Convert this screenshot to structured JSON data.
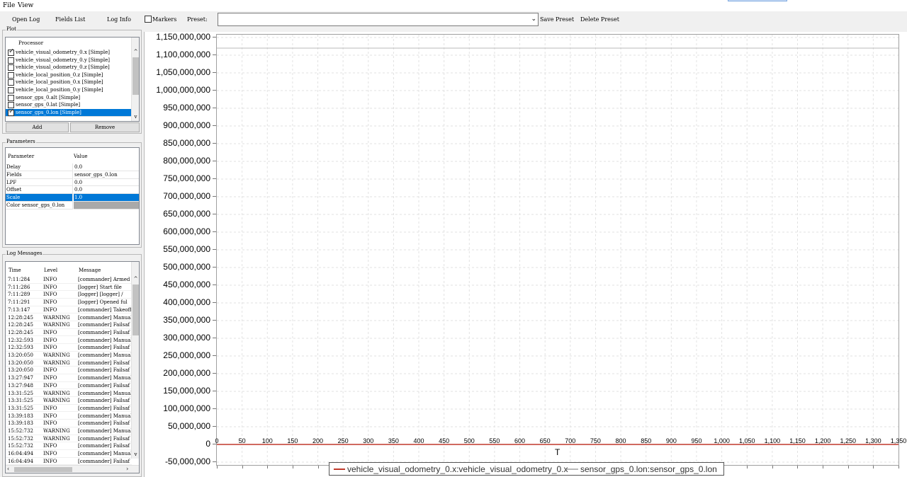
{
  "menu": {
    "file": "File",
    "view": "View"
  },
  "toolbar": {
    "open_log": "Open Log",
    "fields_list": "Fields List",
    "log_info": "Log Info",
    "markers": "Markers",
    "preset_label": "Preset:",
    "preset_value": "",
    "save_preset": "Save Preset",
    "delete_preset": "Delete Preset"
  },
  "plot_group": {
    "title": "Plot",
    "header": "Processor",
    "items": [
      {
        "label": "vehicle_visual_odometry_0.x [Simple]",
        "checked": true
      },
      {
        "label": "vehicle_visual_odometry_0.y [Simple]",
        "checked": false
      },
      {
        "label": "vehicle_visual_odometry_0.z [Simple]",
        "checked": false
      },
      {
        "label": "vehicle_local_position_0.z [Simple]",
        "checked": false
      },
      {
        "label": "vehicle_local_position_0.x [Simple]",
        "checked": false
      },
      {
        "label": "vehicle_local_position_0.y [Simple]",
        "checked": false
      },
      {
        "label": "sensor_gps_0.alt [Simple]",
        "checked": false
      },
      {
        "label": "sensor_gps_0.lat [Simple]",
        "checked": false
      },
      {
        "label": "sensor_gps_0.lon [Simple]",
        "checked": true,
        "selected": true
      }
    ],
    "add": "Add",
    "remove": "Remove"
  },
  "parameters": {
    "title": "Parameters",
    "col_param": "Parameter",
    "col_value": "Value",
    "rows": [
      {
        "name": "Delay",
        "value": "0.0"
      },
      {
        "name": "Fields",
        "value": "sensor_gps_0.lon"
      },
      {
        "name": "LPF",
        "value": "0.0"
      },
      {
        "name": "Offset",
        "value": "0.0"
      },
      {
        "name": "Scale",
        "value": "1.0",
        "selected": true
      },
      {
        "name": "Color sensor_gps_0.lon",
        "value": ""
      }
    ]
  },
  "log_messages": {
    "title": "Log Messages",
    "col_time": "Time",
    "col_level": "Level",
    "col_message": "Message",
    "rows": [
      [
        "7:11:284",
        "INFO",
        "[commander] Armed b"
      ],
      [
        "7:11:286",
        "INFO",
        "[logger] Start file"
      ],
      [
        "7:11:289",
        "INFO",
        "[logger] [logger] /"
      ],
      [
        "7:11:291",
        "INFO",
        "[logger] Opened ful"
      ],
      [
        "7:13:147",
        "INFO",
        "[commander] Takeoff"
      ],
      [
        "12:28:245",
        "WARNING",
        "[commander] Manual"
      ],
      [
        "12:28:245",
        "WARNING",
        "[commander] Failsaf"
      ],
      [
        "12:28:245",
        "INFO",
        "[commander] Failsaf"
      ],
      [
        "12:32:593",
        "INFO",
        "[commander] Manual"
      ],
      [
        "12:32:593",
        "INFO",
        "[commander] Failsaf"
      ],
      [
        "13:20:050",
        "WARNING",
        "[commander] Manual"
      ],
      [
        "13:20:050",
        "WARNING",
        "[commander] Failsaf"
      ],
      [
        "13:20:050",
        "INFO",
        "[commander] Failsaf"
      ],
      [
        "13:27:947",
        "INFO",
        "[commander] Manual"
      ],
      [
        "13:27:948",
        "INFO",
        "[commander] Failsaf"
      ],
      [
        "13:31:525",
        "WARNING",
        "[commander] Manual"
      ],
      [
        "13:31:525",
        "WARNING",
        "[commander] Failsaf"
      ],
      [
        "13:31:525",
        "INFO",
        "[commander] Failsaf"
      ],
      [
        "13:39:183",
        "INFO",
        "[commander] Manual"
      ],
      [
        "13:39:183",
        "INFO",
        "[commander] Failsaf"
      ],
      [
        "15:52:732",
        "WARNING",
        "[commander] Manual"
      ],
      [
        "15:52:732",
        "WARNING",
        "[commander] Failsaf"
      ],
      [
        "15:52:732",
        "INFO",
        "[commander] Failsaf"
      ],
      [
        "16:04:494",
        "INFO",
        "[commander] Manual"
      ],
      [
        "16:04:494",
        "INFO",
        "[commander] Failsaf"
      ]
    ]
  },
  "chart_data": {
    "type": "line",
    "xlabel": "T",
    "ylabel": "",
    "xlim": [
      0,
      1350
    ],
    "ylim": [
      -50000000,
      1150000000
    ],
    "x_ticks": [
      "0",
      "50",
      "100",
      "150",
      "200",
      "250",
      "300",
      "350",
      "400",
      "450",
      "500",
      "550",
      "600",
      "650",
      "700",
      "750",
      "800",
      "850",
      "900",
      "950",
      "1,000",
      "1,050",
      "1,100",
      "1,150",
      "1,200",
      "1,250",
      "1,300",
      "1,350"
    ],
    "y_ticks": [
      "1,150,000,000",
      "1,100,000,000",
      "1,050,000,000",
      "1,000,000,000",
      "950,000,000",
      "900,000,000",
      "850,000,000",
      "800,000,000",
      "750,000,000",
      "700,000,000",
      "650,000,000",
      "600,000,000",
      "550,000,000",
      "500,000,000",
      "450,000,000",
      "400,000,000",
      "350,000,000",
      "300,000,000",
      "250,000,000",
      "200,000,000",
      "150,000,000",
      "100,000,000",
      "50,000,000",
      "0",
      "-50,000,000"
    ],
    "grid": true,
    "legend_position": "bottom-center",
    "series": [
      {
        "name": "vehicle_visual_odometry_0.x:vehicle_visual_odometry_0.x",
        "color": "#c0392b",
        "x": [
          0,
          1350
        ],
        "y": [
          0,
          0
        ]
      },
      {
        "name": "sensor_gps_0.lon:sensor_gps_0.lon",
        "color": "#b8b8b8",
        "x": [
          0,
          1350
        ],
        "y": [
          1120000000,
          1120000000
        ]
      }
    ]
  }
}
